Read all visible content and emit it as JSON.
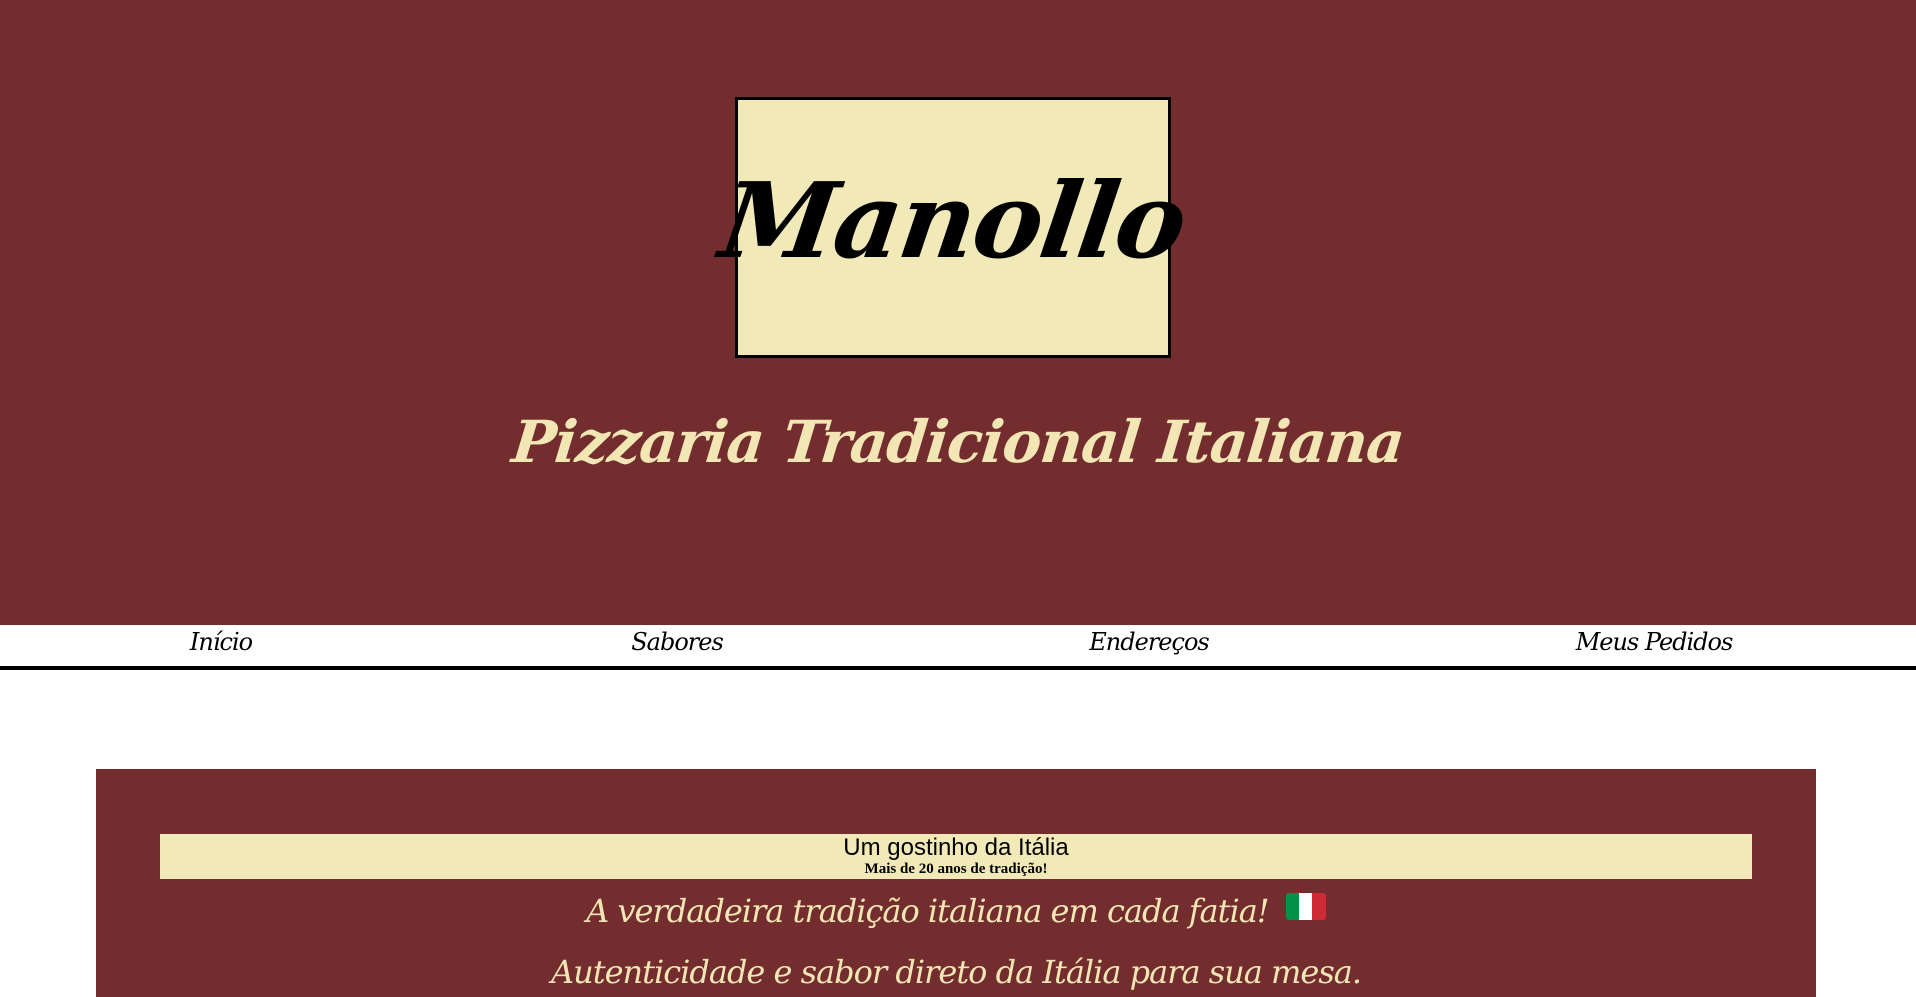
{
  "header": {
    "brand": "Manollo",
    "tagline": "Pizzaria Tradicional Italiana"
  },
  "nav": {
    "items": [
      {
        "label": "Início"
      },
      {
        "label": "Sabores"
      },
      {
        "label": "Endereços"
      },
      {
        "label": "Meus Pedidos"
      }
    ]
  },
  "intro": {
    "title": "Um gostinho da Itália",
    "subtitle": "Mais de 20 anos de tradição!",
    "slogan_1": "A verdadeira tradição italiana em cada fatia!",
    "slogan_2": "Autenticidade e sabor direto da Itália para sua mesa.",
    "flag_icon": "italy-flag-icon"
  },
  "colors": {
    "wine": "#742d2f",
    "cream": "#f1e9b7",
    "cream_text": "#f1e6b4",
    "flag_green": "#009246",
    "flag_white": "#ffffff",
    "flag_red": "#ce2b37"
  }
}
